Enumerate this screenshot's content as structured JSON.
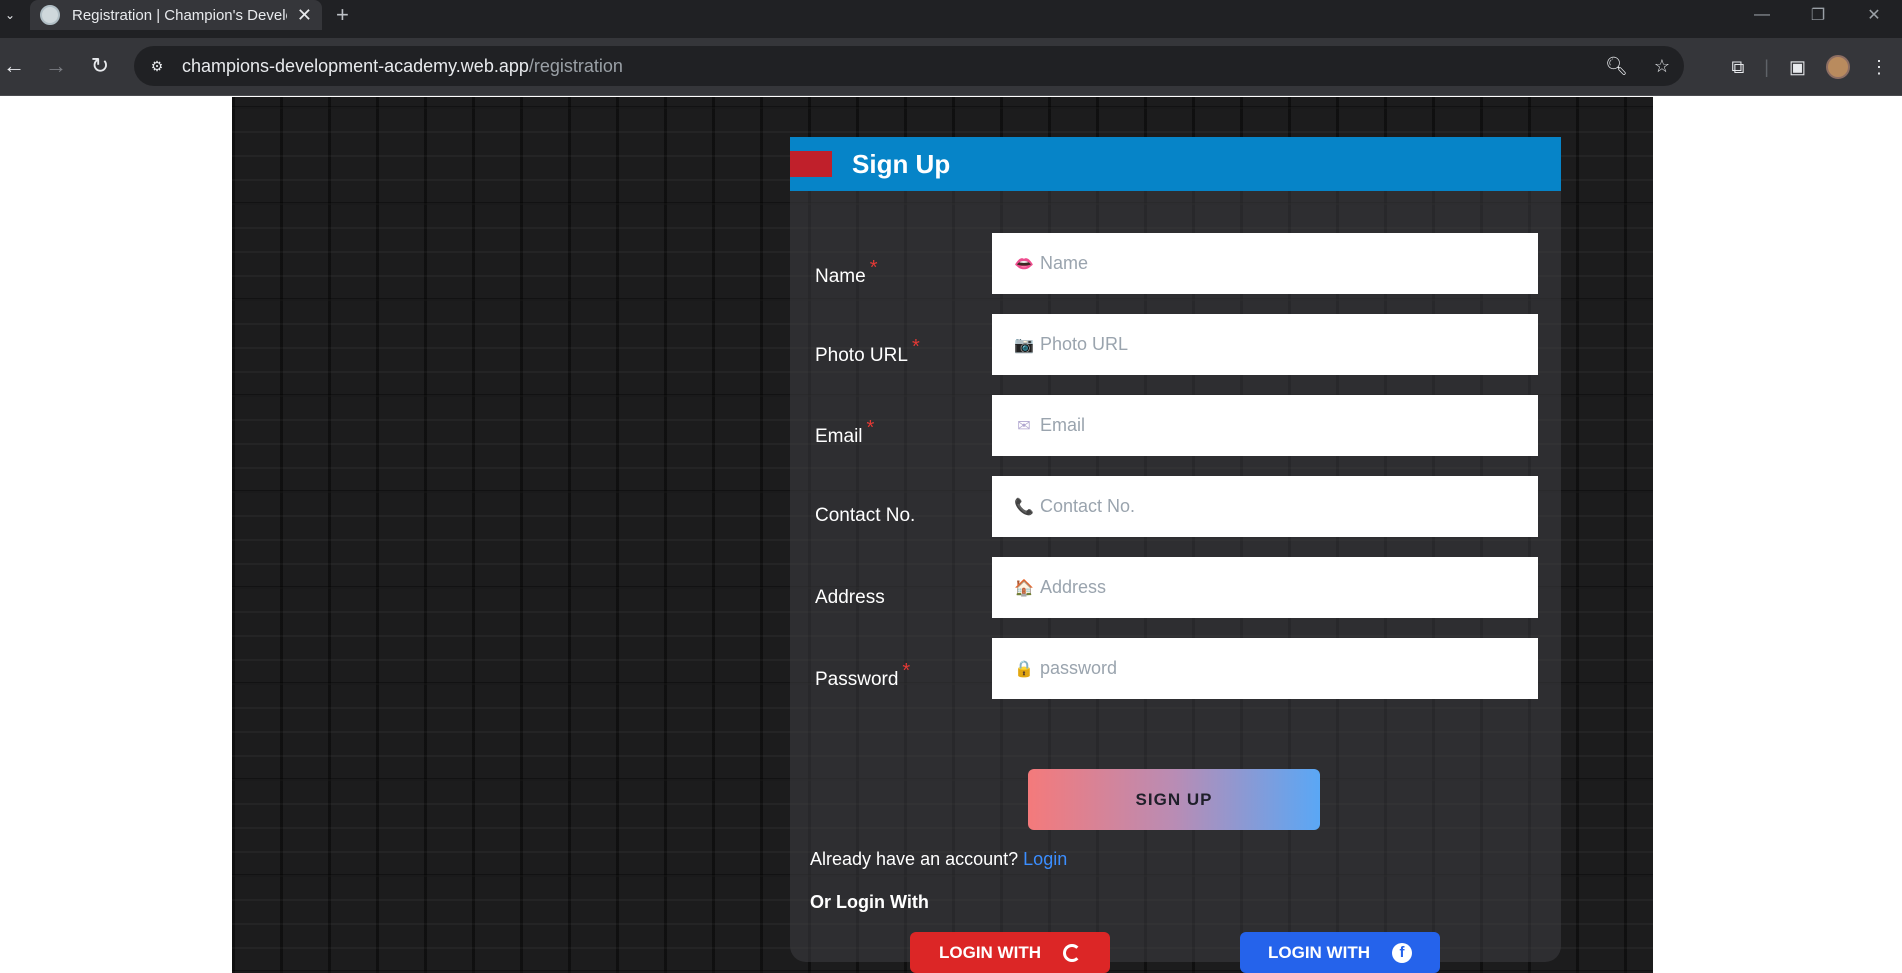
{
  "browser": {
    "tab_title": "Registration | Champion's Development Academy",
    "tab_close": "✕",
    "new_tab": "+",
    "url_host": "champions-development-academy.web.app",
    "url_path": "/registration",
    "win_minimize": "—",
    "win_restore": "❐",
    "win_close": "✕"
  },
  "form": {
    "title": "Sign Up",
    "fields": [
      {
        "label": "Name",
        "required": "*",
        "placeholder": "Name",
        "icon": "👄"
      },
      {
        "label": "Photo URL",
        "required": "*",
        "placeholder": "Photo URL",
        "icon": "📷"
      },
      {
        "label": "Email",
        "required": "*",
        "placeholder": "Email",
        "icon": "✉"
      },
      {
        "label": "Contact No.",
        "required": "",
        "placeholder": "Contact No.",
        "icon": "📞"
      },
      {
        "label": "Address",
        "required": "",
        "placeholder": "Address",
        "icon": "🏠"
      },
      {
        "label": "Password",
        "required": "*",
        "placeholder": "password",
        "icon": "🔒"
      }
    ],
    "submit_label": "SIGN UP",
    "already_text": "Already have an account?",
    "login_link": "Login",
    "or_login_with": "Or Login With",
    "google_label": "LOGIN WITH",
    "facebook_label": "LOGIN WITH",
    "facebook_icon_glyph": "f"
  },
  "colors": {
    "header_bar": "#0684c8",
    "header_accent": "#c0202b",
    "google_button": "#dc2626",
    "facebook_button": "#2563eb",
    "link": "#3b8eff"
  }
}
